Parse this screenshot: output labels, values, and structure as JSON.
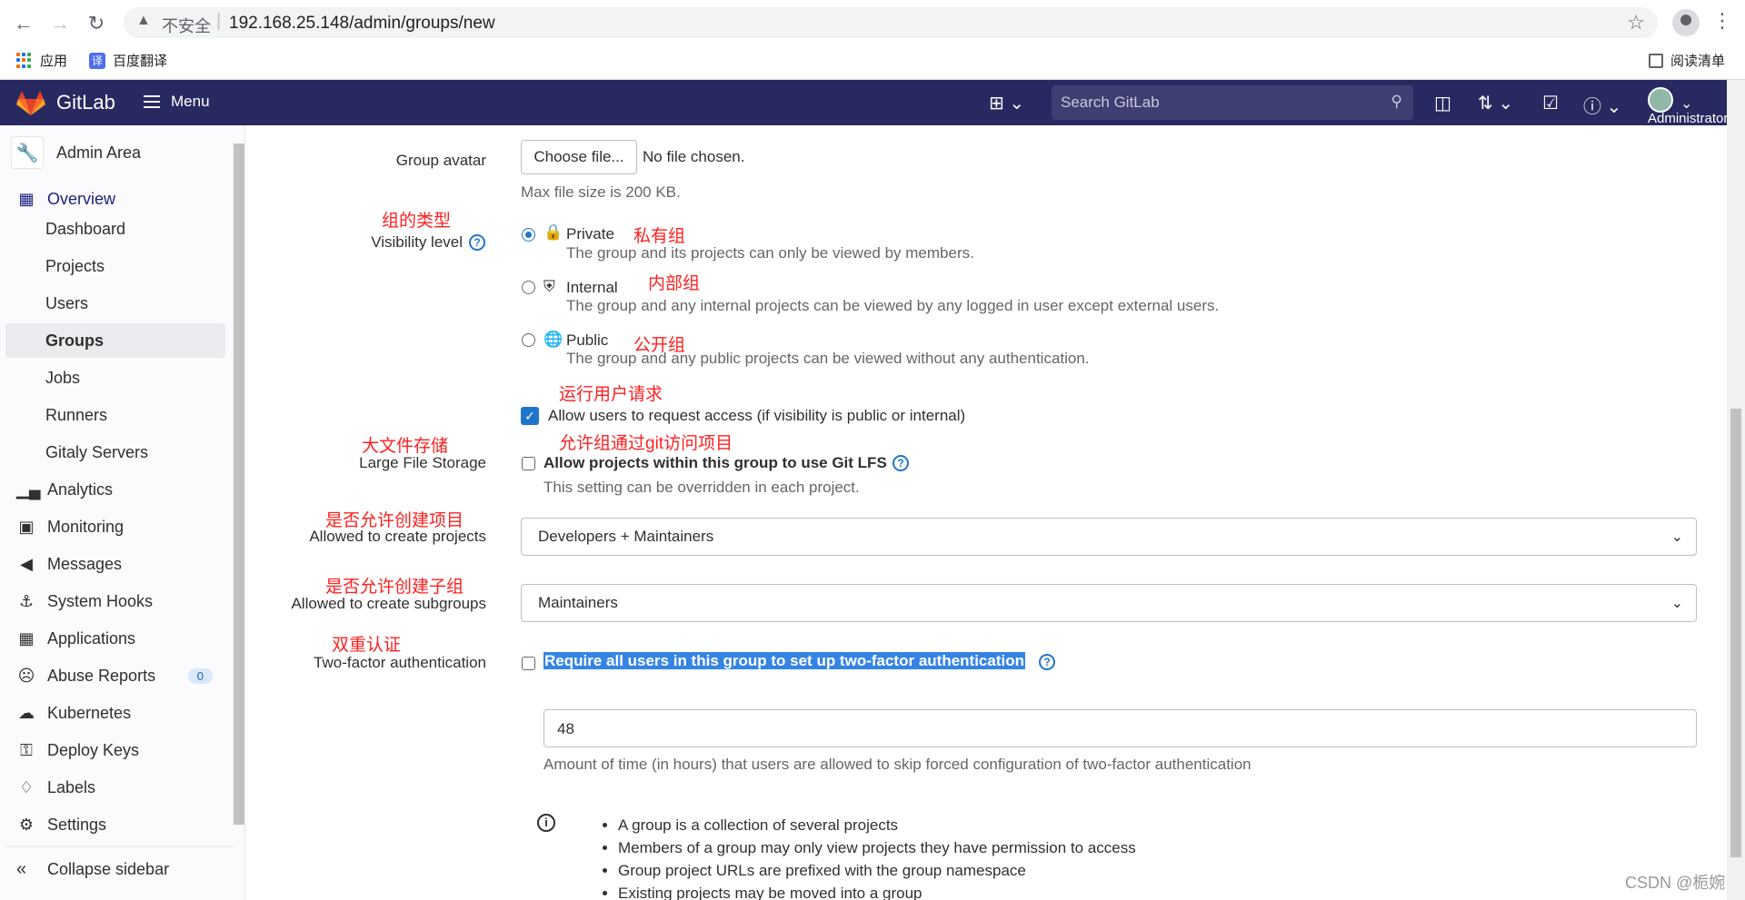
{
  "browser": {
    "insecure": "不安全",
    "url": "192.168.25.148/admin/groups/new",
    "bookmarks": {
      "apps": "应用",
      "translate": "百度翻译",
      "reading_list": "阅读清单"
    }
  },
  "header": {
    "brand": "GitLab",
    "menu": "Menu",
    "search_placeholder": "Search GitLab",
    "user": "Administrator"
  },
  "sidebar": {
    "title": "Admin Area",
    "items": [
      {
        "label": "Overview",
        "icon": "overview-icon"
      },
      {
        "label": "Dashboard"
      },
      {
        "label": "Projects"
      },
      {
        "label": "Users"
      },
      {
        "label": "Groups"
      },
      {
        "label": "Jobs"
      },
      {
        "label": "Runners"
      },
      {
        "label": "Gitaly Servers"
      },
      {
        "label": "Analytics",
        "icon": "analytics-icon"
      },
      {
        "label": "Monitoring",
        "icon": "monitor-icon"
      },
      {
        "label": "Messages",
        "icon": "messages-icon"
      },
      {
        "label": "System Hooks",
        "icon": "hook-icon"
      },
      {
        "label": "Applications",
        "icon": "applications-icon"
      },
      {
        "label": "Abuse Reports",
        "icon": "abuse-icon",
        "badge": "0"
      },
      {
        "label": "Kubernetes",
        "icon": "kubernetes-icon"
      },
      {
        "label": "Deploy Keys",
        "icon": "key-icon"
      },
      {
        "label": "Labels",
        "icon": "label-icon"
      },
      {
        "label": "Settings",
        "icon": "settings-icon"
      }
    ],
    "collapse": "Collapse sidebar"
  },
  "form": {
    "avatar": {
      "label": "Group avatar",
      "button": "Choose file...",
      "status": "No file chosen.",
      "help": "Max file size is 200 KB."
    },
    "visibility": {
      "annotation": "组的类型",
      "label": "Visibility level",
      "options": [
        {
          "label": "Private",
          "annotation": "私有组",
          "desc": "The group and its projects can only be viewed by members.",
          "checked": true
        },
        {
          "label": "Internal",
          "annotation": "内部组",
          "desc": "The group and any internal projects can be viewed by any logged in user except external users.",
          "checked": false
        },
        {
          "label": "Public",
          "annotation": "公开组",
          "desc": "The group and any public projects can be viewed without any authentication.",
          "checked": false
        }
      ]
    },
    "request_access": {
      "annotation": "运行用户请求",
      "label": "Allow users to request access (if visibility is public or internal)",
      "checked": true
    },
    "lfs": {
      "annotation": "大文件存储",
      "label": "Large File Storage",
      "annotation2": "允许组通过git访问项目",
      "checkbox_label": "Allow projects within this group to use Git LFS",
      "help": "This setting can be overridden in each project."
    },
    "create_projects": {
      "annotation": "是否允许创建项目",
      "label": "Allowed to create projects",
      "value": "Developers + Maintainers"
    },
    "create_subgroups": {
      "annotation": "是否允许创建子组",
      "label": "Allowed to create subgroups",
      "value": "Maintainers"
    },
    "two_factor": {
      "annotation": "双重认证",
      "label": "Two-factor authentication",
      "checkbox_label": "Require all users in this group to set up two-factor authentication",
      "grace_value": "48",
      "grace_help": "Amount of time (in hours) that users are allowed to skip forced configuration of two-factor authentication"
    },
    "info": [
      "A group is a collection of several projects",
      "Members of a group may only view projects they have permission to access",
      "Group project URLs are prefixed with the group namespace",
      "Existing projects may be moved into a group"
    ]
  },
  "watermark": "CSDN @栀婉"
}
